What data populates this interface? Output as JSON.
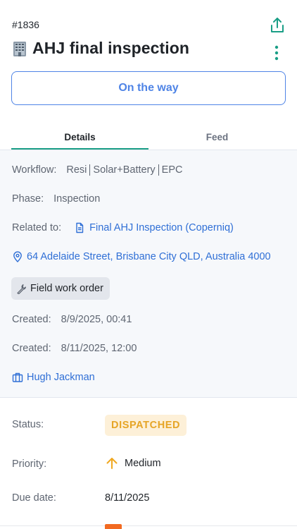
{
  "task": {
    "id": "#1836",
    "title": "AHJ final inspection",
    "title_icon": "office-building-icon"
  },
  "actions": {
    "primary_label": "On the way",
    "share_icon": "share-icon",
    "more_icon": "kebab-menu-icon"
  },
  "tabs": [
    {
      "label": "Details",
      "active": true
    },
    {
      "label": "Feed",
      "active": false
    }
  ],
  "details": {
    "workflow_label": "Workflow:",
    "workflow_parts": [
      "Resi",
      "Solar+Battery",
      "EPC"
    ],
    "phase_label": "Phase:",
    "phase_value": "Inspection",
    "related_label": "Related to:",
    "related_value": "Final AHJ Inspection (Coperniq)",
    "address": "64 Adelaide Street, Brisbane City QLD, Australia 4000",
    "work_order_label": "Field work order",
    "created_1_label": "Created:",
    "created_1_value": "8/9/2025, 00:41",
    "created_2_label": "Created:",
    "created_2_value": "8/11/2025, 12:00",
    "assignee": "Hugh Jackman"
  },
  "meta": {
    "status_label": "Status:",
    "status_value": "DISPATCHED",
    "priority_label": "Priority:",
    "priority_value": "Medium",
    "due_label": "Due date:",
    "due_value": "8/11/2025"
  },
  "colors": {
    "accent_blue": "#4f84e6",
    "link_blue": "#2f6fd6",
    "teal": "#1a9e86",
    "status_text": "#e6a526",
    "status_bg": "#fdf0d8",
    "priority_arrow": "#f0a821"
  }
}
